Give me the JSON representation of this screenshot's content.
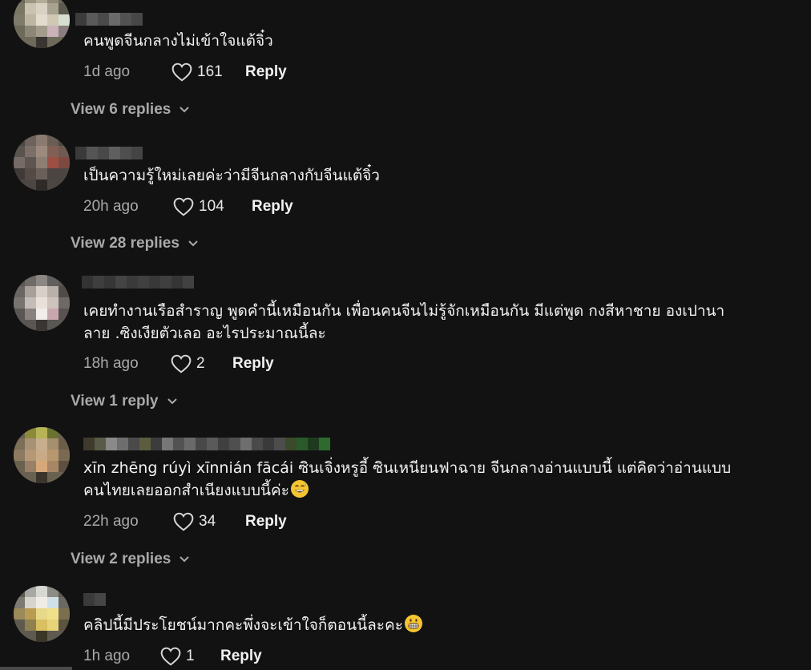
{
  "comments": [
    {
      "text": "คนพูดจีนกลางไม่เข้าใจแต้จิ๋ว",
      "time": "1d ago",
      "likes": "161",
      "reply_label": "Reply",
      "view_replies": "View 6 replies"
    },
    {
      "text": "เป็นความรู้ใหม่เลยค่ะว่ามีจีนกลางกับจีนแต้จิ๋ว",
      "time": "20h ago",
      "likes": "104",
      "reply_label": "Reply",
      "view_replies": "View 28 replies"
    },
    {
      "text_line1": "เคยทำงานเรือสำราญ พูดคำนี้เหมือนกัน เพื่อนคนจีนไม่รู้จักเหมือนกัน มีแต่พูด กงสีหาชาย องเปานา",
      "text_line2": "ลาย .ซิงเงียตัวเลอ อะไรประมาณนี้ละ",
      "time": "18h ago",
      "likes": "2",
      "reply_label": "Reply",
      "view_replies": "View 1 reply"
    },
    {
      "text_line1": "xīn zhēng rúyì xīnnián fācái ซินเจิ่งหรูอี้ ซินเหนียนฟาฉาย จีนกลางอ่านแบบนี้ แต่คิดว่าอ่านแบบ",
      "text_line2": "คนไทยเลยออกสำเนียงแบบนี้ค่ะ",
      "emoji": "sweat-smile",
      "time": "22h ago",
      "likes": "34",
      "reply_label": "Reply",
      "view_replies": "View 2 replies"
    },
    {
      "text": "คลิปนี้มีประโยชน์มากคะพึ่งจะเข้าใจก็ตอนนี้ละคะ",
      "emoji": "grin",
      "time": "1h ago",
      "likes": "1",
      "reply_label": "Reply"
    }
  ],
  "colors": {
    "background": "#121212",
    "text": "#f2f2f2",
    "muted": "#a9a9a9"
  }
}
